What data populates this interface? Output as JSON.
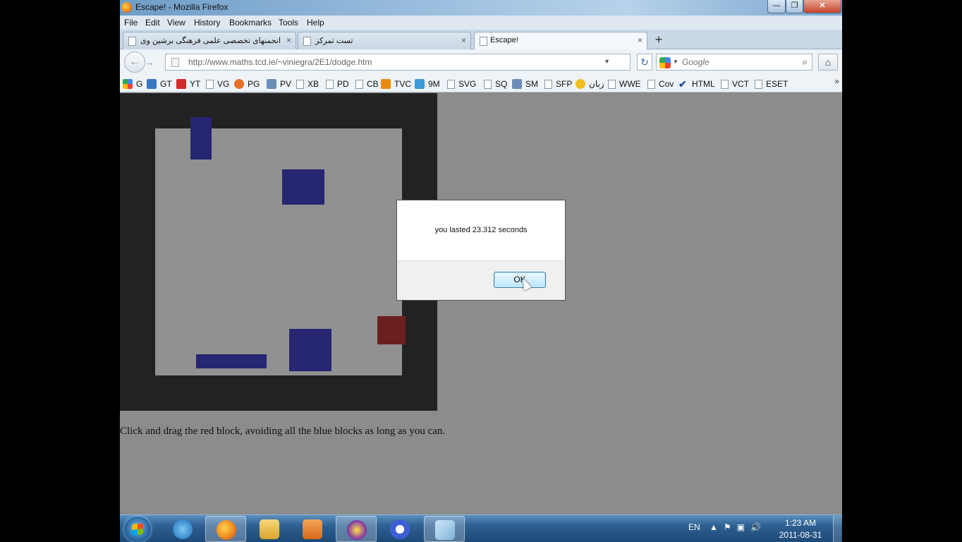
{
  "window": {
    "title": "Escape! - Mozilla Firefox",
    "min": "—",
    "max": "❐",
    "close": "✕"
  },
  "menu": [
    "File",
    "Edit",
    "View",
    "History",
    "Bookmarks",
    "Tools",
    "Help"
  ],
  "tabs": [
    {
      "label": "انجمنهای تخصصی علمی فرهنگی برشین وی",
      "close": "×"
    },
    {
      "label": "تست تمرکز",
      "close": "×"
    },
    {
      "label": "Escape!",
      "close": "×"
    }
  ],
  "new_tab": "+",
  "nav": {
    "back": "←",
    "forward": "→",
    "url": "http://www.maths.tcd.ie/~viniegra/2E1/dodge.htm",
    "reload": "↻",
    "search_placeholder": "Google",
    "search_icon": "⌕",
    "home": "⌂"
  },
  "bookmarks": [
    "G",
    "GT",
    "YT",
    "VG",
    "PG",
    "PV",
    "XB",
    "PD",
    "CB",
    "TVC",
    "9M",
    "SVG",
    "SQ",
    "SM",
    "SFP",
    "زبان",
    "WWE",
    "Cov",
    "HTML",
    "VCT",
    "ESET"
  ],
  "bookmarks_more": "»",
  "game": {
    "instructions": "Click and drag the red block, avoiding all the blue blocks as long as you can."
  },
  "dialog": {
    "message": "you lasted 23.312 seconds",
    "ok": "OK"
  },
  "taskbar": {
    "lang": "EN",
    "time": "1:23 AM",
    "date": "2011-08-31"
  },
  "colors": {
    "blue_block": "#262673",
    "red_block": "#6b1f1f",
    "frame": "#222222",
    "field": "#919191"
  }
}
